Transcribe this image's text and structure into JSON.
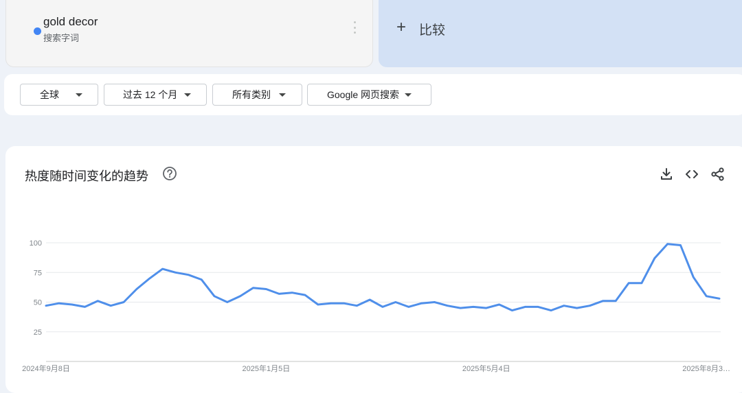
{
  "term": {
    "name": "gold decor",
    "type": "搜索字词",
    "dot_color": "#4285f4"
  },
  "compare": {
    "label": "比较"
  },
  "filters": {
    "region": "全球",
    "time": "过去 12 个月",
    "category": "所有类别",
    "source": "Google 网页搜索"
  },
  "chart_header": {
    "title": "热度随时间变化的趋势",
    "icons": [
      "help-icon",
      "download-icon",
      "embed-code-icon",
      "share-icon"
    ]
  },
  "chart_data": {
    "type": "line",
    "title": "热度随时间变化的趋势",
    "ylim": [
      0,
      100
    ],
    "y_ticks": [
      25,
      50,
      75,
      100
    ],
    "x_tick_labels": [
      "2024年9月8日",
      "2025年1月5日",
      "2025年5月4日",
      "2025年8月3…"
    ],
    "x_tick_positions": [
      0,
      17,
      34,
      51
    ],
    "grid": true,
    "series": [
      {
        "color": "#4f8fea",
        "values": [
          47,
          49,
          48,
          46,
          51,
          47,
          50,
          61,
          70,
          78,
          75,
          73,
          69,
          55,
          50,
          55,
          62,
          61,
          57,
          58,
          56,
          48,
          49,
          49,
          47,
          52,
          46,
          50,
          46,
          49,
          50,
          47,
          45,
          46,
          45,
          48,
          43,
          46,
          46,
          43,
          47,
          45,
          47,
          51,
          51,
          66,
          66,
          87,
          99,
          98,
          71,
          55,
          53
        ]
      }
    ]
  }
}
